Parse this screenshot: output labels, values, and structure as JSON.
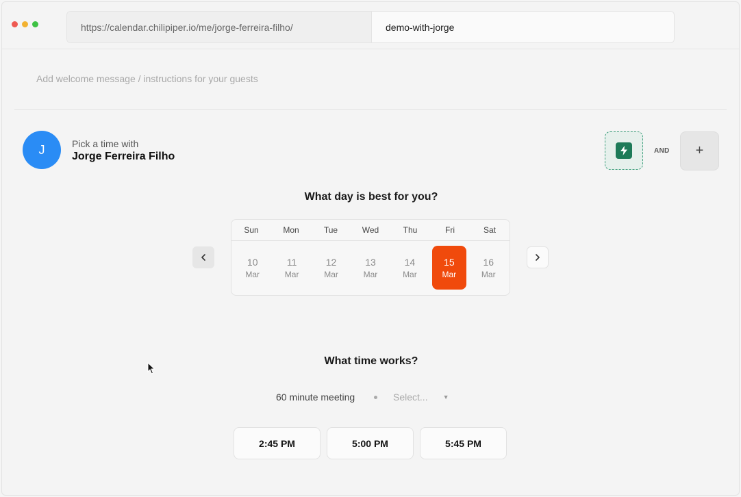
{
  "browser": {
    "url_base": "https://calendar.chilipiper.io/me/jorge-ferreira-filho/",
    "url_slug": "demo-with-jorge"
  },
  "welcome": {
    "placeholder": "Add welcome message / instructions for your guests"
  },
  "host": {
    "avatar_initial": "J",
    "pick_label": "Pick a time with",
    "name": "Jorge Ferreira Filho"
  },
  "rules": {
    "and_label": "AND",
    "add_label": "+"
  },
  "day_picker": {
    "heading": "What day is best for you?",
    "weekdays": [
      "Sun",
      "Mon",
      "Tue",
      "Wed",
      "Thu",
      "Fri",
      "Sat"
    ],
    "days": [
      {
        "num": "10",
        "month": "Mar"
      },
      {
        "num": "11",
        "month": "Mar"
      },
      {
        "num": "12",
        "month": "Mar"
      },
      {
        "num": "13",
        "month": "Mar"
      },
      {
        "num": "14",
        "month": "Mar"
      },
      {
        "num": "15",
        "month": "Mar"
      },
      {
        "num": "16",
        "month": "Mar"
      }
    ],
    "selected_day": "15",
    "prev_icon": "chevron-left-icon",
    "next_icon": "chevron-right-icon"
  },
  "time_picker": {
    "heading": "What time works?",
    "duration": "60 minute meeting",
    "select_placeholder": "Select...",
    "slots": [
      "2:45 PM",
      "5:00 PM",
      "5:45 PM"
    ]
  },
  "colors": {
    "accent": "#f04a0c",
    "avatar": "#2a8cf5",
    "rule_green": "#1d7a58"
  }
}
